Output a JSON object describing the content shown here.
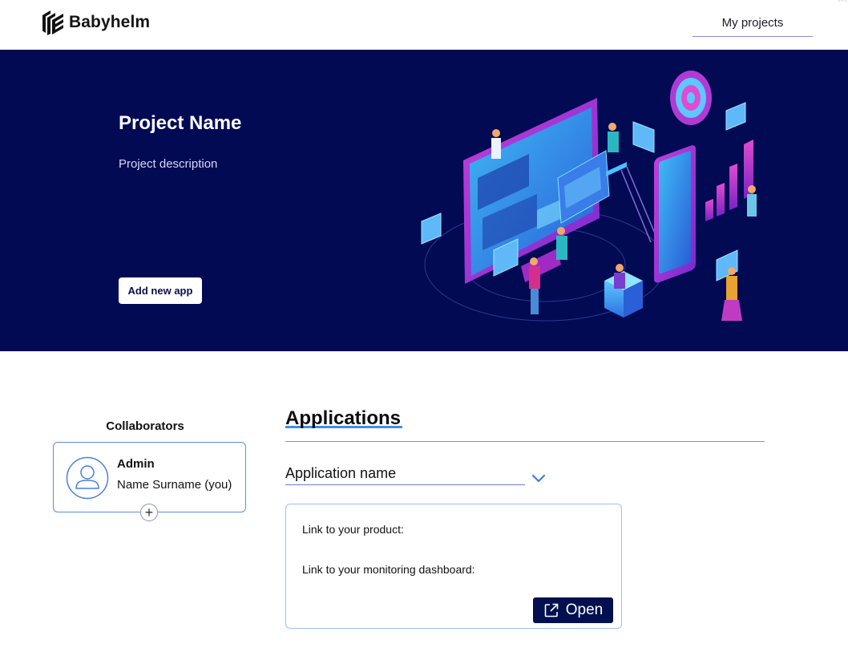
{
  "header": {
    "brand": "Babyhelm",
    "nav_link": "My projects",
    "corner_text": "we"
  },
  "hero": {
    "title": "Project Name",
    "description": "Project description",
    "add_app_button": "Add new app"
  },
  "collaborators": {
    "title": "Collaborators",
    "items": [
      {
        "role": "Admin",
        "name": "Name Surname (you)"
      }
    ],
    "add_label": "+"
  },
  "applications": {
    "title": "Applications",
    "selected_app": "Application name",
    "card": {
      "product_link_label": "Link to your product:",
      "dashboard_link_label": "Link to your monitoring dashboard:",
      "open_button": "Open"
    }
  },
  "colors": {
    "hero_bg": "#020a54",
    "accent": "#3d8ff0",
    "button_dark": "#03104f",
    "card_border": "#5b8de0"
  }
}
